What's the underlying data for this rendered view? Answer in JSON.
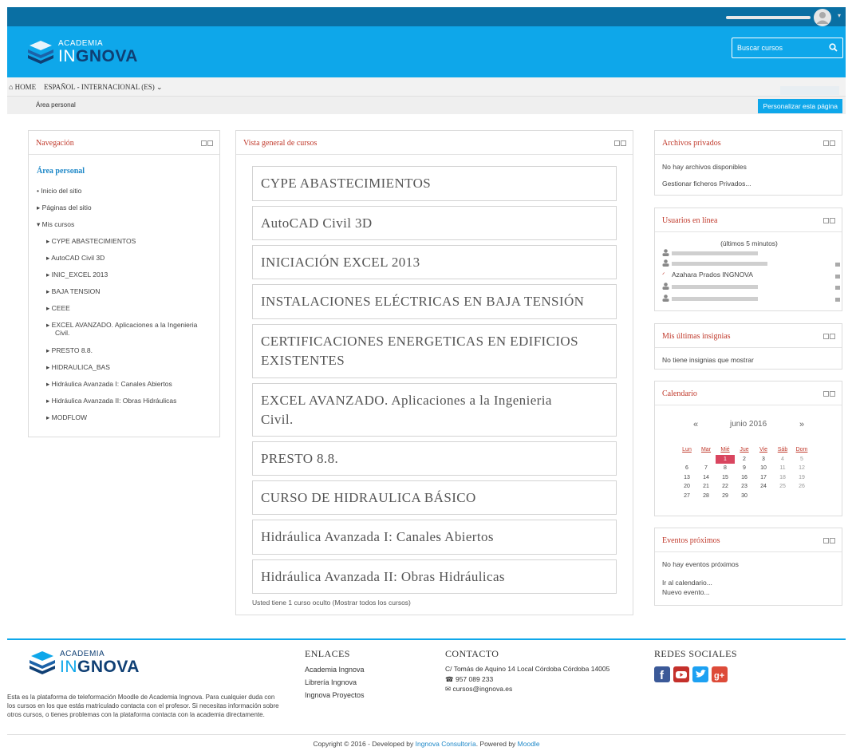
{
  "header": {
    "logo_top": "ACADEMIA",
    "logo_in": "IN",
    "logo_nova": "GNOVA",
    "search_placeholder": "Buscar cursos"
  },
  "navbar": {
    "home": "HOME",
    "language": "ESPAÑOL - INTERNACIONAL (ES)"
  },
  "breadcrumb": {
    "current": "Área personal",
    "customize_button": "Personalizar esta página"
  },
  "navigation": {
    "title": "Navegación",
    "home_label": "Área personal",
    "items": [
      "Inicio del sitio",
      "Páginas del sitio",
      "Mis cursos"
    ],
    "courses": [
      "CYPE ABASTECIMIENTOS",
      "AutoCAD Civil 3D",
      "INIC_EXCEL 2013",
      "BAJA TENSION",
      "CEEE",
      "EXCEL AVANZADO. Aplicaciones a la Ingenieria",
      "Civil.",
      "PRESTO 8.8.",
      "HIDRAULICA_BAS",
      "Hidráulica Avanzada I: Canales Abiertos",
      "Hidráulica Avanzada II: Obras Hidráulicas",
      "MODFLOW"
    ]
  },
  "overview": {
    "title": "Vista general de cursos",
    "courses": [
      "CYPE ABASTECIMIENTOS",
      "AutoCAD Civil 3D",
      "INICIACIÓN EXCEL 2013",
      "INSTALACIONES ELÉCTRICAS EN BAJA TENSIÓN",
      "CERTIFICACIONES ENERGETICAS EN EDIFICIOS",
      "EXISTENTES",
      "EXCEL AVANZADO. Aplicaciones a la Ingenieria",
      "Civil.",
      "PRESTO 8.8.",
      "CURSO DE HIDRAULICA BÁSICO",
      "Hidráulica Avanzada I: Canales Abiertos",
      "Hidráulica Avanzada II: Obras Hidráulicas"
    ],
    "hidden_note": "Usted tiene 1 curso oculto (Mostrar todos los cursos)"
  },
  "private_files": {
    "title": "Archivos privados",
    "empty": "No hay archivos disponibles",
    "manage": "Gestionar ficheros Privados..."
  },
  "online_users": {
    "title": "Usuarios en línea",
    "subtitle": "(últimos 5 minutos)",
    "named_user": "Azahara Prados INGNOVA"
  },
  "badges": {
    "title": "Mis últimas insignias",
    "empty": "No tiene insignias que mostrar"
  },
  "calendar": {
    "title": "Calendario",
    "prev": "«",
    "next": "»",
    "month": "junio 2016",
    "days": [
      "Lun",
      "Mar",
      "Mié",
      "Jue",
      "Vie",
      "Sáb",
      "Dom"
    ],
    "weeks": [
      [
        "",
        "",
        "1",
        "2",
        "3",
        "4",
        "5"
      ],
      [
        "6",
        "7",
        "8",
        "9",
        "10",
        "11",
        "12"
      ],
      [
        "13",
        "14",
        "15",
        "16",
        "17",
        "18",
        "19"
      ],
      [
        "20",
        "21",
        "22",
        "23",
        "24",
        "25",
        "26"
      ],
      [
        "27",
        "28",
        "29",
        "30",
        "",
        "",
        ""
      ]
    ],
    "today": "1"
  },
  "events": {
    "title": "Eventos próximos",
    "empty": "No hay eventos próximos",
    "go_calendar": "Ir al calendario...",
    "new_event": "Nuevo evento..."
  },
  "footer": {
    "description": "Esta es la plataforma de teleformación Moodle de Academia Ingnova. Para cualquier duda con los cursos en los que estás matriculado contacta con el profesor. Si necesitas información sobre otros cursos, o tienes problemas con la plataforma contacta con la academia directamente.",
    "links_title": "ENLACES",
    "links": [
      "Academia Ingnova",
      "Librería Ingnova",
      "Ingnova Proyectos"
    ],
    "contact_title": "CONTACTO",
    "address": "C/ Tomás de Aquino 14 Local Córdoba Córdoba 14005",
    "phone": "957 089 233",
    "email": "cursos@ingnova.es",
    "social_title": "REDES SOCIALES",
    "copyright_pre": "Copyright © 2016 - Developed by ",
    "copyright_link1": "Ingnova Consultoría",
    "copyright_mid": ". Powered by ",
    "copyright_link2": "Moodle",
    "colors": {
      "facebook": "#3b5998",
      "youtube": "#c4302b",
      "twitter": "#1da1f2",
      "google_plus": "#dd4b39"
    }
  }
}
